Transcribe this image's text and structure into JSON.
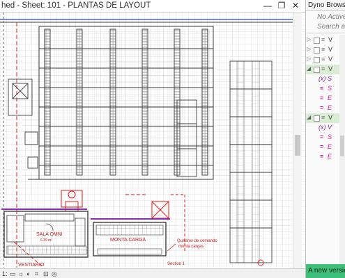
{
  "window": {
    "title": "hed - Sheet: 101 - PLANTAS DE LAYOUT",
    "minimize_glyph": "—",
    "restore_glyph": "❐",
    "close_glyph": "✕"
  },
  "drawing": {
    "room_sala_omni": "SALA OMNI",
    "room_sala_omni_area": "6.39 m²",
    "room_monta_carga": "MONTA CARGA",
    "annotation_quadros": "Quadros de comando",
    "annotation_monta_cargas": "monta cargas",
    "room_vestiario": "VESTIARIO",
    "section_tag": "Section 1",
    "colors": {
      "grid": "#b9b9b9",
      "dark_lines": "#3a3a3a",
      "blue_lines": "#2c4fd0",
      "red_lines": "#e01c1c",
      "purple_lines": "#8a2bb8"
    }
  },
  "statusbar": {
    "scale_text": "1:",
    "icons": [
      "sun-icon",
      "shadows-icon",
      "crop-icon",
      "lock-icon",
      "hide-icon"
    ]
  },
  "dyno": {
    "title": "Dyno Browser",
    "no_active": "No Active",
    "search_placeholder": "Search and",
    "rows": [
      {
        "kind": "group",
        "label": "V",
        "selected": false
      },
      {
        "kind": "group",
        "label": "V",
        "selected": false
      },
      {
        "kind": "group",
        "label": "V",
        "selected": false
      },
      {
        "kind": "group-open",
        "label": "V",
        "selected": true
      },
      {
        "kind": "var",
        "label": "(x)",
        "text": "S"
      },
      {
        "kind": "eq",
        "label": "=",
        "text": "S"
      },
      {
        "kind": "eq",
        "label": "=",
        "text": "E"
      },
      {
        "kind": "eq",
        "label": "=",
        "text": "E"
      },
      {
        "kind": "group-open",
        "label": "V",
        "selected": true
      },
      {
        "kind": "var",
        "label": "(x)",
        "text": "V"
      },
      {
        "kind": "eq",
        "label": "=",
        "text": "S"
      },
      {
        "kind": "eq",
        "label": "=",
        "text": "E"
      },
      {
        "kind": "eq",
        "label": "=",
        "text": "E"
      }
    ],
    "new_version": "A new version",
    "accent": "#3fc07a"
  }
}
